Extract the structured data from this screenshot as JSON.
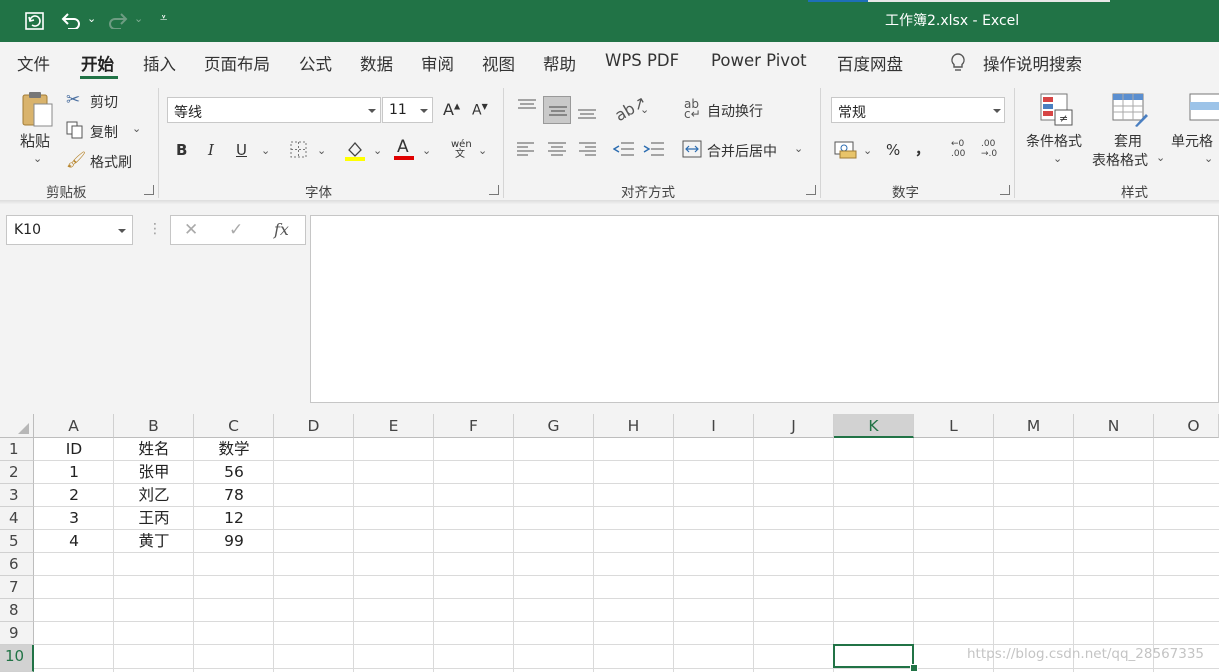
{
  "title_bar": {
    "document_title": "工作簿2.xlsx  -  Excel",
    "icons": [
      "autosave-icon",
      "undo-icon",
      "redo-icon",
      "customize-qat-icon"
    ]
  },
  "colors": {
    "excel_green": "#217346",
    "ribbon_bg": "#f3f3f3",
    "grid_line": "#dadada"
  },
  "tabs": [
    {
      "label": "文件"
    },
    {
      "label": "开始",
      "active": true
    },
    {
      "label": "插入"
    },
    {
      "label": "页面布局"
    },
    {
      "label": "公式"
    },
    {
      "label": "数据"
    },
    {
      "label": "审阅"
    },
    {
      "label": "视图"
    },
    {
      "label": "帮助"
    },
    {
      "label": "WPS PDF"
    },
    {
      "label": "Power Pivot"
    },
    {
      "label": "百度网盘"
    }
  ],
  "tell_me": {
    "label": "操作说明搜索",
    "icon": "lightbulb-icon"
  },
  "ribbon": {
    "clipboard": {
      "group_label": "剪贴板",
      "paste_label": "粘贴",
      "cut_label": "剪切",
      "copy_label": "复制",
      "format_painter_label": "格式刷"
    },
    "font": {
      "group_label": "字体",
      "font_name": "等线",
      "font_size": "11",
      "bold": "B",
      "italic": "I",
      "underline": "U",
      "font_color_letter": "A",
      "phonetic_label": "wén 文"
    },
    "alignment": {
      "group_label": "对齐方式",
      "wrap_text_label": "自动换行",
      "merge_center_label": "合并后居中"
    },
    "number": {
      "group_label": "数字",
      "format": "常规",
      "percent": "%",
      "comma": "，",
      "inc_decimal": "←0 .00",
      "dec_decimal": ".00 →.0"
    },
    "styles": {
      "group_label": "样式",
      "conditional_format_label": "条件格式",
      "table_format_label_1": "套用",
      "table_format_label_2": "表格格式",
      "cell_styles_label": "单元格"
    }
  },
  "formula_bar": {
    "name_box": "K10",
    "cancel": "✕",
    "enter": "✓",
    "fx": "fx",
    "formula": ""
  },
  "sheet": {
    "columns": [
      "A",
      "B",
      "C",
      "D",
      "E",
      "F",
      "G",
      "H",
      "I",
      "J",
      "K",
      "L",
      "M",
      "N",
      "O"
    ],
    "selected_column": "K",
    "rows": [
      "1",
      "2",
      "3",
      "4",
      "5",
      "6",
      "7",
      "8",
      "9",
      "10"
    ],
    "selected_row": "10",
    "cells": [
      [
        "ID",
        "姓名",
        "数学"
      ],
      [
        "1",
        "张甲",
        "56"
      ],
      [
        "2",
        "刘乙",
        "78"
      ],
      [
        "3",
        "王丙",
        "12"
      ],
      [
        "4",
        "黄丁",
        "99"
      ]
    ],
    "active_cell": "K10"
  },
  "watermark": "https://blog.csdn.net/qq_28567335"
}
